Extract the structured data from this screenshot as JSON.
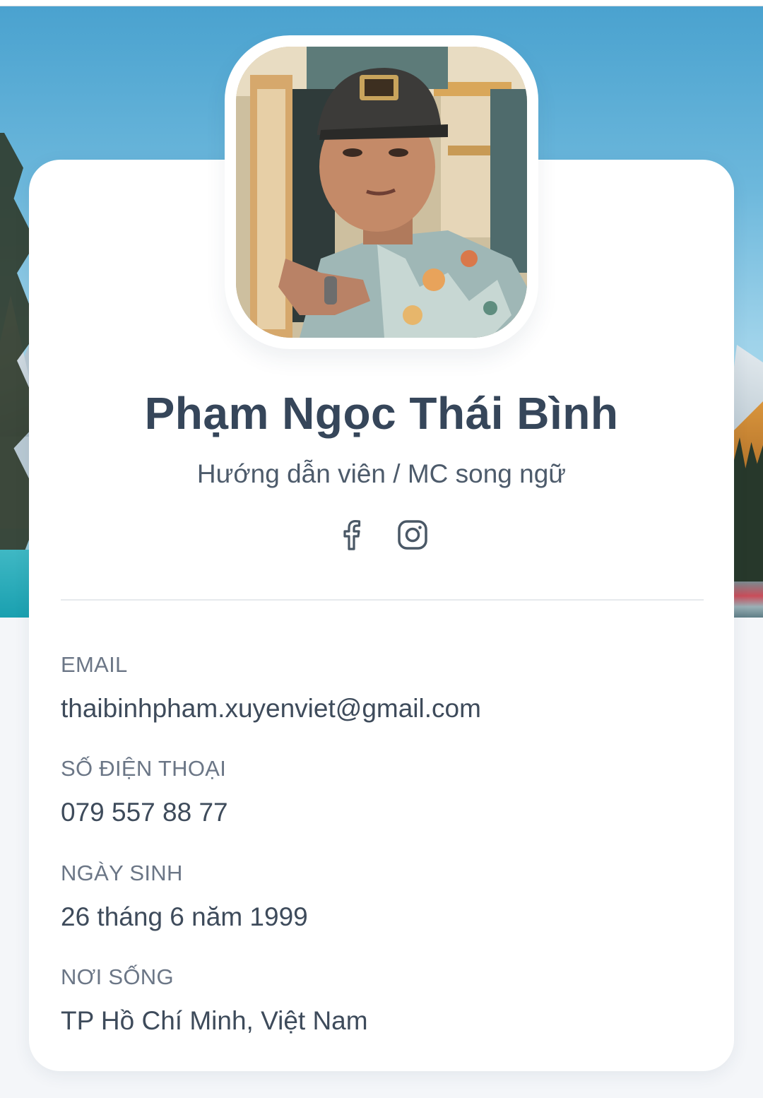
{
  "profile": {
    "name": "Phạm Ngọc Thái Bình",
    "role": "Hướng dẫn viên / MC song ngữ"
  },
  "socials": [
    {
      "name": "facebook",
      "icon": "facebook-icon"
    },
    {
      "name": "instagram",
      "icon": "instagram-icon"
    }
  ],
  "fields": {
    "email": {
      "label": "EMAIL",
      "value": "thaibinhpham.xuyenviet@gmail.com"
    },
    "phone": {
      "label": "SỐ ĐIỆN THOẠI",
      "value": "079 557 88 77"
    },
    "birthday": {
      "label": "NGÀY SINH",
      "value": "26 tháng 6 năm 1999"
    },
    "location": {
      "label": "NƠI SỐNG",
      "value": "TP Hồ Chí Minh, Việt Nam"
    }
  },
  "colors": {
    "name_text": "#36465a",
    "body_text": "#3e4b5b",
    "label_text": "#6b7686",
    "card_bg": "#ffffff",
    "page_bg": "#f4f6f9",
    "sky": "#4aa2cf"
  }
}
